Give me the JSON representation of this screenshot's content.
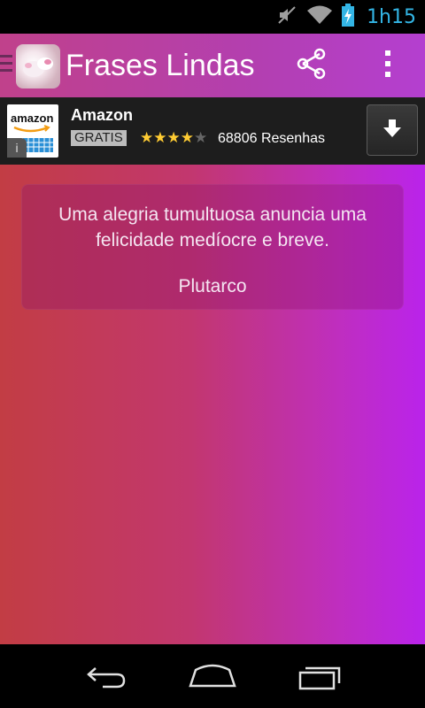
{
  "status_bar": {
    "time": "1h15",
    "icons": [
      "mute-icon",
      "wifi-icon",
      "battery-charging-icon"
    ]
  },
  "action_bar": {
    "title": "Frases Lindas e",
    "icons": [
      "drawer-indicator-icon",
      "app-icon",
      "share-icon",
      "overflow-menu-icon"
    ]
  },
  "ad": {
    "logo_text": "amazon",
    "name": "Amazon",
    "badge": "GRATIS",
    "rating": 4,
    "max_rating": 5,
    "reviews": "68806 Resenhas",
    "icons": [
      "info-icon",
      "download-icon"
    ],
    "colors": {
      "star": "#ffcc33"
    }
  },
  "quote": {
    "text": "Uma alegria tumultuosa anuncia uma felicidade medíocre e breve.",
    "author": "Plutarco"
  },
  "nav_bar": {
    "icons": [
      "back-icon",
      "home-icon",
      "recents-icon"
    ]
  },
  "colors": {
    "accent": "#33b5e5",
    "gradient_left": "#c23d44",
    "gradient_right": "#ba23eb"
  }
}
